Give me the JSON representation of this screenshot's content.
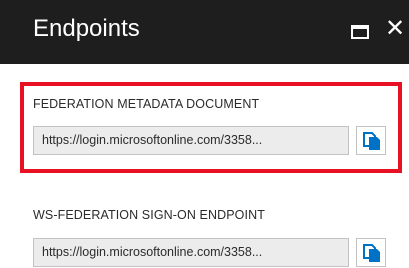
{
  "panel": {
    "title": "Endpoints",
    "maximize_icon": "maximize-icon",
    "close_glyph": "✕"
  },
  "endpoints": [
    {
      "label": "FEDERATION METADATA DOCUMENT",
      "url": "https://login.microsoftonline.com/3358...",
      "highlighted": true
    },
    {
      "label": "WS-FEDERATION SIGN-ON ENDPOINT",
      "url": "https://login.microsoftonline.com/3358...",
      "highlighted": false
    }
  ],
  "colors": {
    "header_bg": "#1e1e1e",
    "highlight": "#e81123",
    "copy_icon": "#0072c6"
  }
}
